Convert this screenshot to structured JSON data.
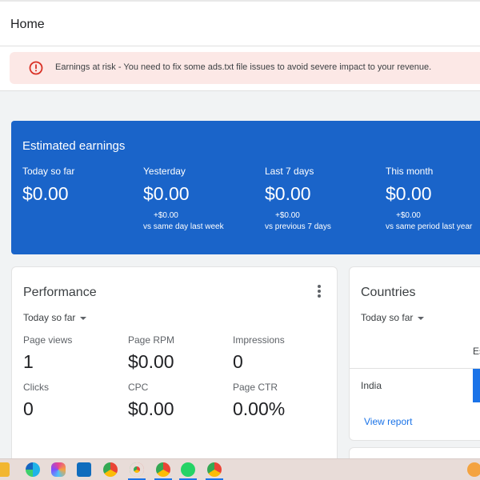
{
  "header": {
    "title": "Home"
  },
  "alert": {
    "text": "Earnings at risk - You need to fix some ads.txt file issues to avoid severe impact to your revenue.",
    "color": "#d93025"
  },
  "earnings": {
    "title": "Estimated earnings",
    "items": [
      {
        "label": "Today so far",
        "value": "$0.00",
        "delta": "",
        "compare": ""
      },
      {
        "label": "Yesterday",
        "value": "$0.00",
        "delta": "+$0.00",
        "compare": "vs same day last week"
      },
      {
        "label": "Last 7 days",
        "value": "$0.00",
        "delta": "+$0.00",
        "compare": "vs previous 7 days"
      },
      {
        "label": "This month",
        "value": "$0.00",
        "delta": "+$0.00",
        "compare": "vs same period last year"
      }
    ],
    "color": "#1a64c9"
  },
  "performance": {
    "title": "Performance",
    "range": "Today so far",
    "metrics": [
      {
        "label": "Page views",
        "value": "1"
      },
      {
        "label": "Page RPM",
        "value": "$0.00"
      },
      {
        "label": "Impressions",
        "value": "0"
      },
      {
        "label": "Clicks",
        "value": "0"
      },
      {
        "label": "CPC",
        "value": "$0.00"
      },
      {
        "label": "Page CTR",
        "value": "0.00%"
      }
    ]
  },
  "countries": {
    "title": "Countries",
    "range": "Today so far",
    "column_header": "Es",
    "rows": [
      {
        "country": "India"
      }
    ],
    "link": "View report"
  },
  "taskbar": {
    "icons": [
      "file-explorer-icon",
      "edge-icon",
      "copilot-icon",
      "outlook-icon",
      "chrome-icon",
      "chrome-profile-icon",
      "chrome-profile-icon",
      "whatsapp-icon",
      "chrome-profile-icon",
      "weather-icon"
    ]
  }
}
